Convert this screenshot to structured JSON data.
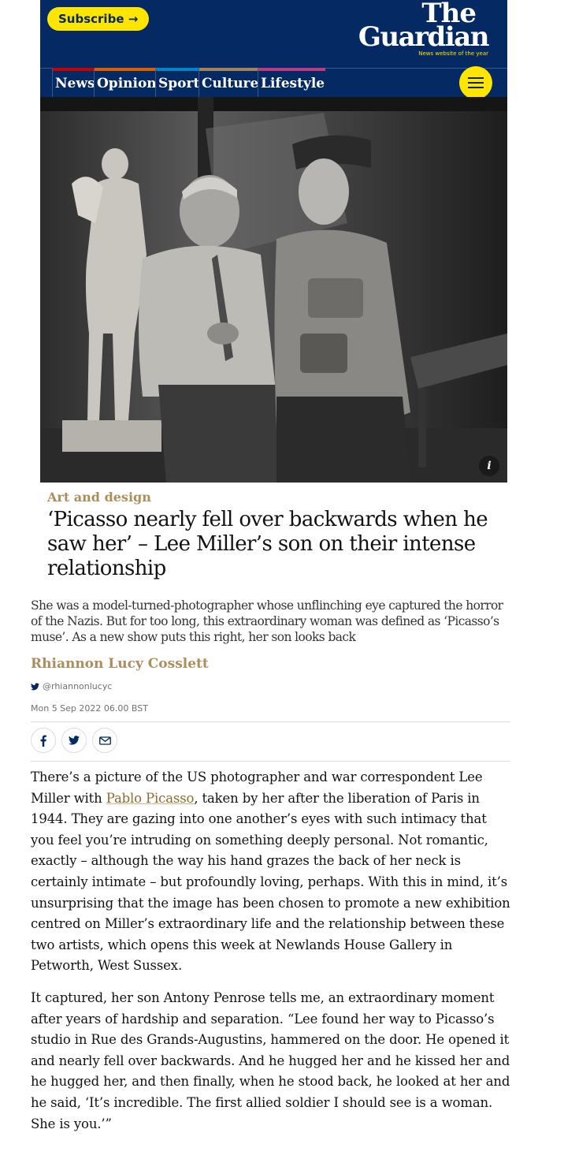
{
  "header": {
    "subscribe_label": "Subscribe →",
    "logo_line1": "The",
    "logo_line2": "Guardian",
    "logo_tagline": "News website of the year",
    "nav": [
      "News",
      "Opinion",
      "Sport",
      "Culture",
      "Lifestyle"
    ],
    "nav_colors": [
      "#c70000",
      "#e05e00",
      "#0084c6",
      "#a1845c",
      "#bb3b80"
    ],
    "menu_icon": "hamburger-menu-icon"
  },
  "hero": {
    "info_label": "i"
  },
  "article": {
    "kicker": "Art and design",
    "headline": "‘Picasso nearly fell over backwards when he saw her’ – Lee Miller’s son on their intense relationship",
    "standfirst": "She was a model-turned-photographer whose unflinching eye captured the horror of the Nazis. But for too long, this extraordinary woman was defined as ‘Picasso’s muse’. As a new show puts this right, her son looks back",
    "byline": "Rhiannon Lucy Cosslett",
    "twitter_handle": "@rhiannonlucyc",
    "date": "Mon 5 Sep 2022 06.00 BST",
    "share_icons": [
      "facebook-icon",
      "twitter-icon",
      "email-icon"
    ],
    "paragraph1_start": "There’s a picture of the US photographer and war correspondent Lee Miller with ",
    "paragraph1_link": "Pablo Picasso",
    "paragraph1_end": ", taken by her after the liberation of Paris in 1944. They are gazing into one another’s eyes with such intimacy that you feel you’re intruding on something deeply personal. Not romantic, exactly – although the way his hand grazes the back of her neck is certainly intimate – but profoundly loving, perhaps. With this in mind, it’s unsurprising that the image has been chosen to promote a new exhibition centred on Miller’s extraordinary life and the relationship between these two artists, which opens this week at Newlands House Gallery in Petworth, West Sussex.",
    "paragraph2": "It captured, her son Antony Penrose tells me, an extraordinary moment after years of hardship and separation. “Lee found her way to Picasso’s studio in Rue des Grands-Augustins, hammered on the door. He opened it and nearly fell over backwards. And he hugged her and he kissed her and he hugged her, and then finally, when he stood back, he looked at her and he said, ‘It’s incredible. The first allied soldier I should see is a woman. She is you.’”"
  },
  "colors": {
    "brand_blue": "#052962",
    "brand_yellow": "#ffe500",
    "culture_gold": "#ab8e5c"
  }
}
